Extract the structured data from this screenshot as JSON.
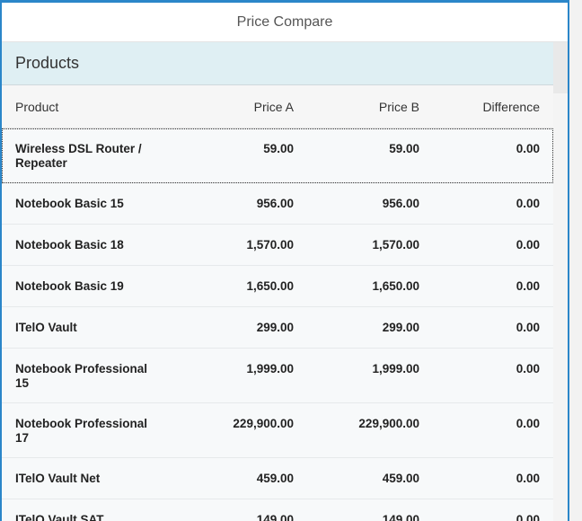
{
  "app": {
    "title": "Price Compare"
  },
  "panel": {
    "title": "Products"
  },
  "table": {
    "columns": [
      "Product",
      "Price A",
      "Price B",
      "Difference"
    ],
    "rows": [
      {
        "product": "Wireless DSL Router / Repeater",
        "price_a": "59.00",
        "price_b": "59.00",
        "difference": "0.00"
      },
      {
        "product": "Notebook Basic 15",
        "price_a": "956.00",
        "price_b": "956.00",
        "difference": "0.00"
      },
      {
        "product": "Notebook Basic 18",
        "price_a": "1,570.00",
        "price_b": "1,570.00",
        "difference": "0.00"
      },
      {
        "product": "Notebook Basic 19",
        "price_a": "1,650.00",
        "price_b": "1,650.00",
        "difference": "0.00"
      },
      {
        "product": "ITelO Vault",
        "price_a": "299.00",
        "price_b": "299.00",
        "difference": "0.00"
      },
      {
        "product": "Notebook Professional 15",
        "price_a": "1,999.00",
        "price_b": "1,999.00",
        "difference": "0.00"
      },
      {
        "product": "Notebook Professional 17",
        "price_a": "229,900.00",
        "price_b": "229,900.00",
        "difference": "0.00"
      },
      {
        "product": "ITelO Vault Net",
        "price_a": "459.00",
        "price_b": "459.00",
        "difference": "0.00"
      },
      {
        "product": "ITelO Vault SAT",
        "price_a": "149.00",
        "price_b": "149.00",
        "difference": "0.00"
      }
    ]
  }
}
